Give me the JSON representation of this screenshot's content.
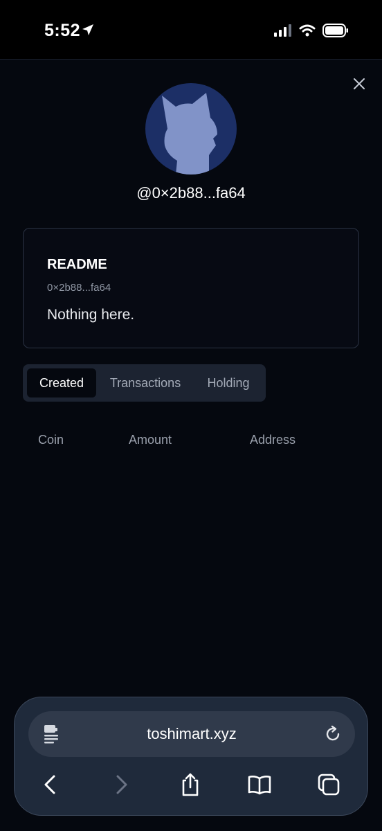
{
  "status_bar": {
    "time": "5:52"
  },
  "profile": {
    "handle": "@0×2b88...fa64"
  },
  "readme": {
    "title": "README",
    "address": "0×2b88...fa64",
    "body": "Nothing here."
  },
  "tabs": [
    {
      "label": "Created",
      "active": true
    },
    {
      "label": "Transactions",
      "active": false
    },
    {
      "label": "Holding",
      "active": false
    }
  ],
  "table": {
    "columns": [
      "Coin",
      "Amount",
      "Address"
    ]
  },
  "browser": {
    "url": "toshimart.xyz"
  },
  "colors": {
    "background": "#05080f",
    "avatar_bg": "#1c2f66",
    "avatar_figure": "#8193c8",
    "tab_bg": "#1c2331",
    "browser_bg": "#1f2a3b"
  }
}
